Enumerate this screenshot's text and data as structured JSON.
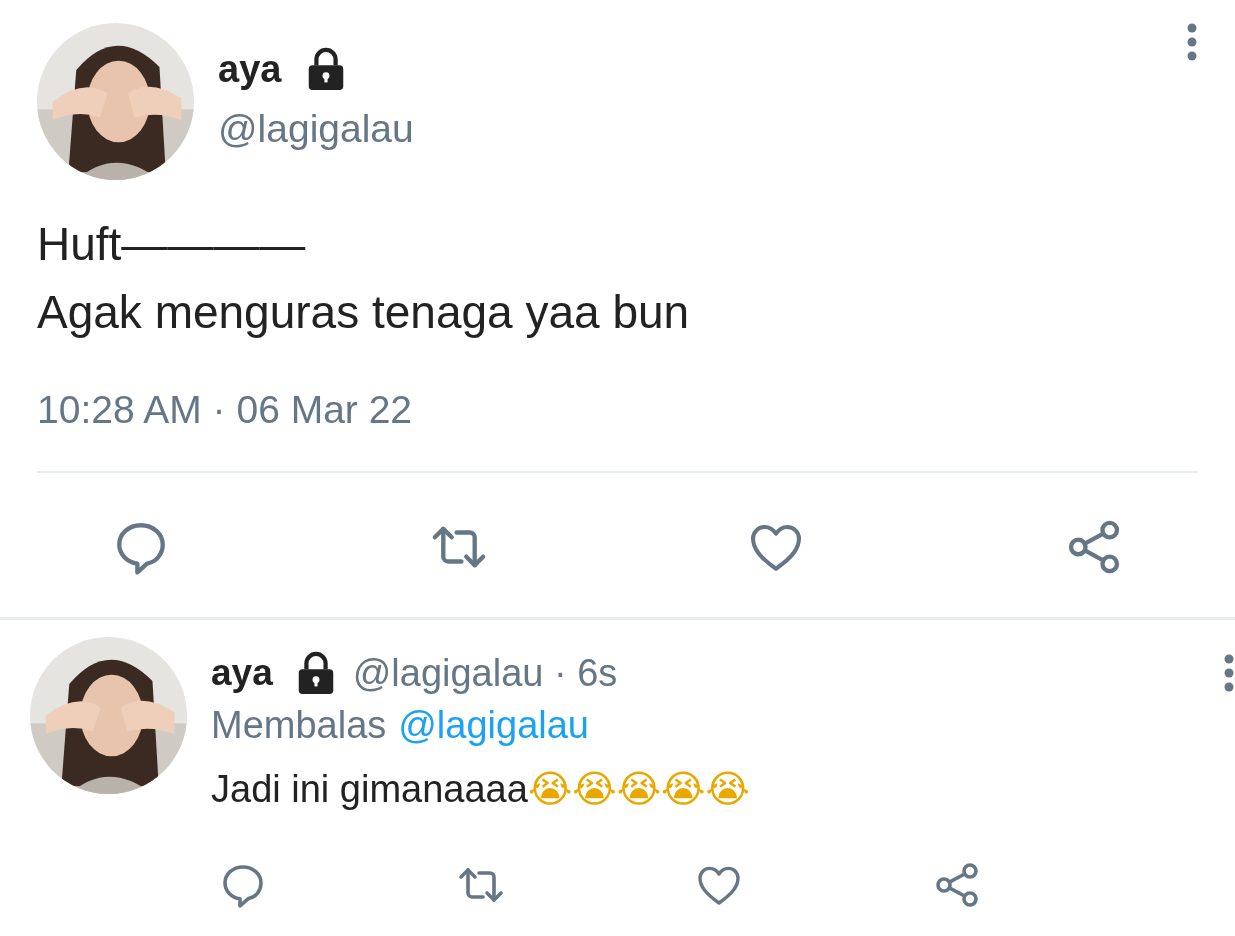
{
  "tweet": {
    "kind": "main",
    "name": "aya",
    "protected": true,
    "handle": "@lagigalau",
    "lines": [
      "Huft————",
      "Agak menguras tenaga yaa bun"
    ],
    "timestamp": "10:28 AM · 06 Mar 22"
  },
  "reply": {
    "kind": "reply",
    "name": "aya",
    "protected": true,
    "handle": "@lagigalau · 6s",
    "replying_label": "Membalas",
    "replying_to": "@lagigalau",
    "text": "Jadi ini gimanaaaa😭😭😭😭😭"
  }
}
